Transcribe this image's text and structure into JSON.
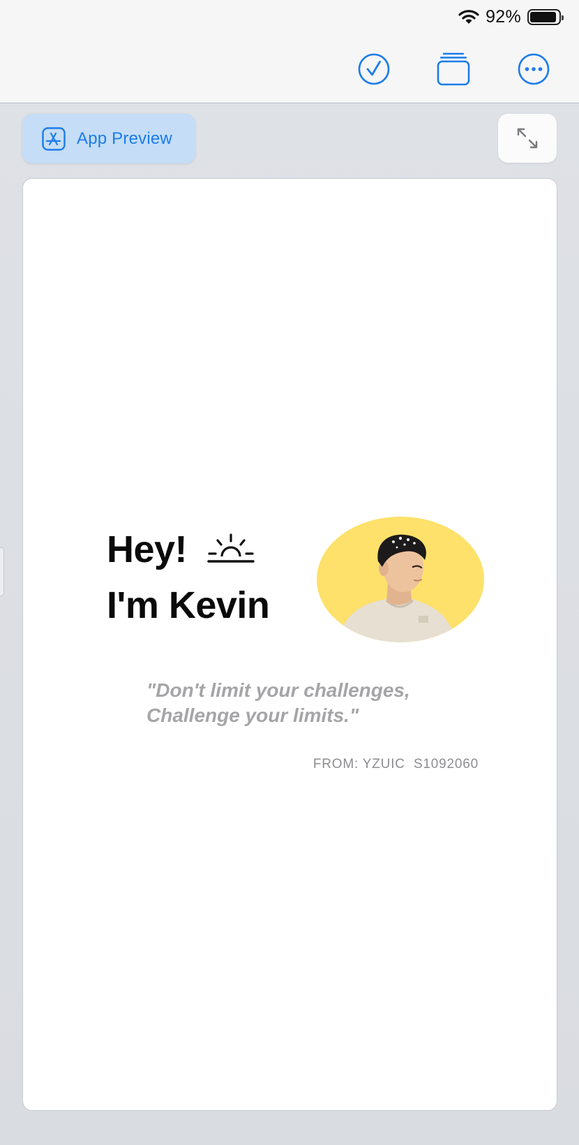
{
  "status_bar": {
    "battery_percent": "92%",
    "battery_level": 0.92
  },
  "toolbar": {
    "icons": [
      "checkmark-circle-icon",
      "layers-icon",
      "more-icon"
    ],
    "accent": "#1c7ce9"
  },
  "app_preview": {
    "label": "App Preview",
    "icon": "app-store-icon"
  },
  "expand_icon": "expand-arrows-icon",
  "preview": {
    "greeting_line1": "Hey!",
    "greeting_line2": "I'm Kevin",
    "sun_icon": "sunrise-icon",
    "avatar": "profile-photo",
    "avatar_bg": "#fde16a",
    "quote_line1": "\"Don't limit your challenges,",
    "quote_line2": "Challenge your limits.\"",
    "attribution": "FROM: YZUIC  S1092060"
  }
}
